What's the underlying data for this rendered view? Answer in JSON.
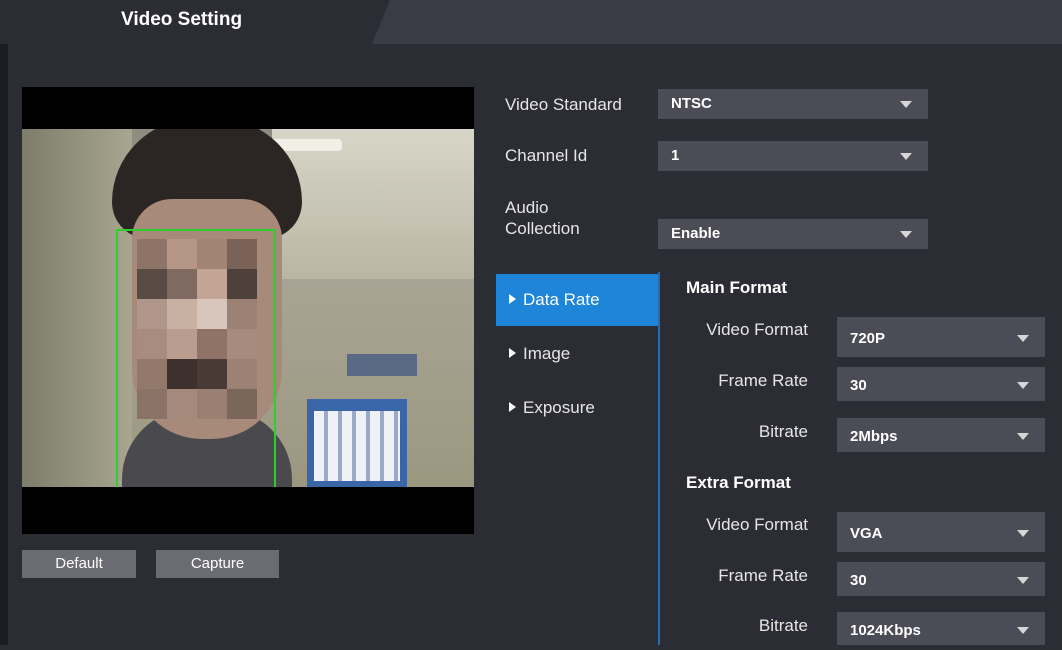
{
  "page": {
    "title": "Video Setting"
  },
  "buttons": {
    "default": "Default",
    "capture": "Capture"
  },
  "settings": {
    "video_standard": {
      "label": "Video Standard",
      "value": "NTSC"
    },
    "channel_id": {
      "label": "Channel Id",
      "value": "1"
    },
    "audio_collection": {
      "label_line1": "Audio",
      "label_line2": "Collection",
      "value": "Enable"
    }
  },
  "menu": {
    "items": [
      {
        "label": "Data Rate",
        "active": true
      },
      {
        "label": "Image",
        "active": false
      },
      {
        "label": "Exposure",
        "active": false
      }
    ]
  },
  "main_format": {
    "heading": "Main Format",
    "video_format": {
      "label": "Video Format",
      "value": "720P"
    },
    "frame_rate": {
      "label": "Frame Rate",
      "value": "30"
    },
    "bitrate": {
      "label": "Bitrate",
      "value": "2Mbps"
    }
  },
  "extra_format": {
    "heading": "Extra Format",
    "video_format": {
      "label": "Video Format",
      "value": "VGA"
    },
    "frame_rate": {
      "label": "Frame Rate",
      "value": "30"
    },
    "bitrate": {
      "label": "Bitrate",
      "value": "1024Kbps"
    }
  },
  "colors": {
    "background": "#2c2d34",
    "accent": "#1f85d8",
    "field": "#4b4c55",
    "face_box": "#2ccf2c"
  }
}
